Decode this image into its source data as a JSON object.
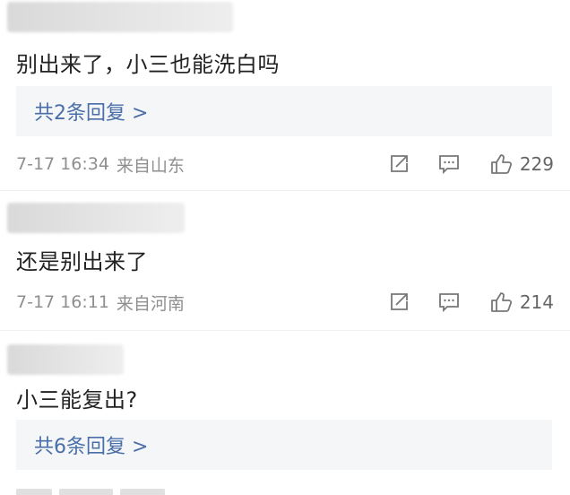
{
  "comments": [
    {
      "text": "别出来了，小三也能洗白吗",
      "replies_label": "共2条回复 >",
      "time": "7-17 16:34",
      "location": "来自山东",
      "likes": "229"
    },
    {
      "text": "还是别出来了",
      "time": "7-17 16:11",
      "location": "来自河南",
      "likes": "214"
    },
    {
      "text": "小三能复出?",
      "replies_label": "共6条回复 >"
    }
  ]
}
